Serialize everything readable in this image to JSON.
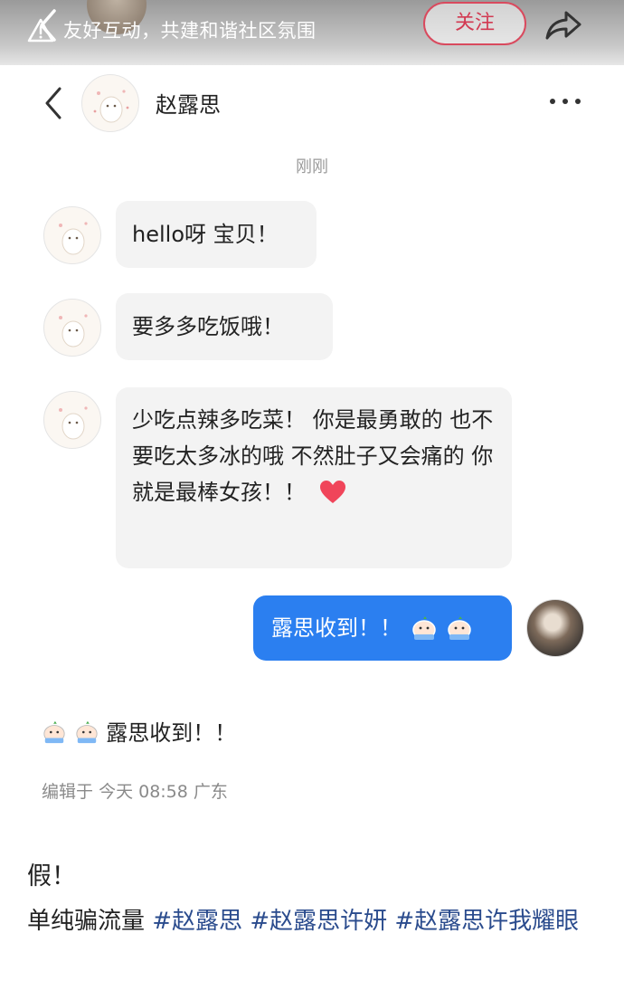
{
  "header": {
    "slogan": "友好互动，共建和谐社区氛围",
    "follow_label": "关注"
  },
  "chat": {
    "contact_name": "赵露思",
    "timestamp": "刚刚",
    "messages_in": [
      "hello呀 宝贝！",
      "要多多吃饭哦！",
      "少吃点辣多吃菜！ 你是最勇敢的 也不要吃太多冰的哦 不然肚子又会痛的 你就是最棒女孩！！"
    ],
    "message_out": "露思收到！！"
  },
  "post": {
    "repeat_text": "露思收到！！",
    "edited_label": "编辑于",
    "edited_time": "今天 08:58",
    "edited_location": "广东",
    "title": "假！",
    "body_prefix": "单纯骗流量 ",
    "tags": [
      "#赵露思",
      "#赵露思许妍",
      "#赵露思许我耀眼"
    ]
  },
  "colors": {
    "bubble_out": "#2b7ff0",
    "bubble_in": "#f3f3f3",
    "follow": "#d23a52",
    "tag": "#2a4b8d"
  },
  "icons": [
    "back-icon",
    "warning-icon",
    "share-icon",
    "more-icon",
    "heart-emoji",
    "crying-face-emoji"
  ]
}
